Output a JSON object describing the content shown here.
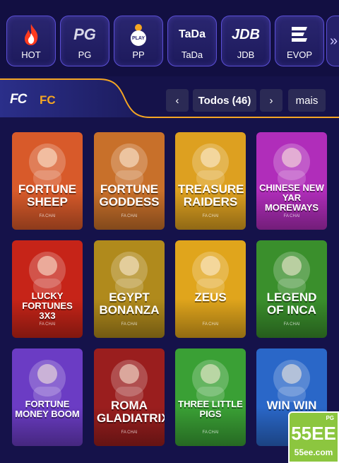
{
  "providers": [
    {
      "label": "HOT",
      "icon": "flame-icon"
    },
    {
      "label": "PG",
      "logo_text": "PG"
    },
    {
      "label": "PP",
      "logo_text": "PLAY"
    },
    {
      "label": "TaDa",
      "logo_text": "TaDa"
    },
    {
      "label": "JDB",
      "logo_text": "JDB"
    },
    {
      "label": "EVOP",
      "icon": "evop-icon"
    }
  ],
  "providers_more": "»",
  "section": {
    "logo_text": "FC",
    "title": "FC",
    "prev": "‹",
    "filter_label": "Todos (46)",
    "next": "›",
    "more_label": "mais"
  },
  "games": [
    {
      "name": "Fortune Sheep",
      "provider": "FA CHAI",
      "color": "#d85a2a"
    },
    {
      "name": "Fortune Goddess",
      "provider": "FA CHAI",
      "color": "#c8702a"
    },
    {
      "name": "Treasure Raiders",
      "provider": "FA CHAI",
      "color": "#dda020"
    },
    {
      "name": "Chinese New Yar Moreways",
      "provider": "FA CHAI",
      "color": "#b02dba"
    },
    {
      "name": "Lucky Fortunes 3x3",
      "provider": "FA CHAI",
      "color": "#c62418"
    },
    {
      "name": "Egypt Bonanza",
      "provider": "FA CHAI",
      "color": "#b08a1c"
    },
    {
      "name": "Zeus",
      "provider": "FA CHAI",
      "color": "#e0a51c"
    },
    {
      "name": "Legend of Inca",
      "provider": "FA CHAI",
      "color": "#3a8f2c"
    },
    {
      "name": "Fortune Money Boom",
      "provider": "",
      "color": "#6b3cc4"
    },
    {
      "name": "Roma Gladiatrix",
      "provider": "FA CHAI",
      "color": "#9a1e1e"
    },
    {
      "name": "Three Little Pigs",
      "provider": "FA CHAI",
      "color": "#3aa035"
    },
    {
      "name": "Win Win",
      "provider": "",
      "color": "#2a67c8"
    }
  ],
  "watermark": {
    "badge": "PG",
    "big": "55EE",
    "site": "55ee.com"
  }
}
